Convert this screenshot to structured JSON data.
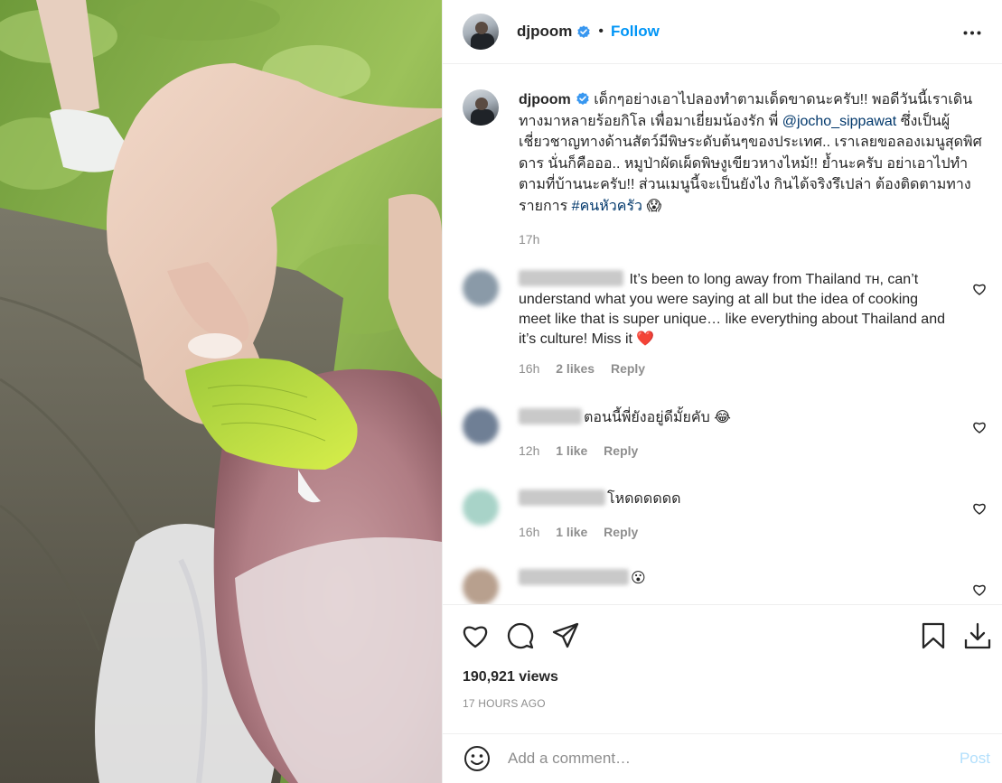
{
  "post": {
    "username": "djpoom",
    "follow_label": "Follow",
    "dot": "•",
    "caption_part1": " เด็กๆอย่างเอาไปลองทำตามเด็ดขาดนะครับ!! พอดีวันนี้เราเดินทางมาหลายร้อยกิโล เพื่อมาเยี่ยมน้องรัก พี่ ",
    "mention": "@jocho_sippawat",
    "caption_part2": " ซึ่งเป็นผู้เชี่ยวชาญทางด้านสัตว์มีพิษระดับต้นๆของประเทศ.. เราเลยขอลองเมนูสุดพิศดาร นั่นก็คือออ.. หมูป่าผัดเผ็ดพิษงูเขียวหางไหม้!! ย้ำนะครับ อย่าเอาไปทำตามที่บ้านนะครับ!! ส่วนเมนูนี้จะเป็นยังไง กินได้จริงรึเปล่า ต้องติดตามทางรายการ ",
    "hashtag": "#คนหัวครัว",
    "caption_emoji": "😱",
    "caption_time": "17h"
  },
  "comments": [
    {
      "text": "It’s been to long away from Thailand ᴛʜ, can’t understand what you were saying at all but the idea of cooking meet like that is super unique… like everything about Thailand and it’s culture! Miss it ❤️",
      "time": "16h",
      "likes": "2 likes",
      "reply": "Reply",
      "avatar_color": "#8a9aa8"
    },
    {
      "text": "ตอนนี้พี่ยังอยู่ดีมั้ยคับ 😂",
      "time": "12h",
      "likes": "1 like",
      "reply": "Reply",
      "avatar_color": "#6f7f95"
    },
    {
      "text": "โหดดดดดด",
      "time": "16h",
      "likes": "1 like",
      "reply": "Reply",
      "avatar_color": "#a8d3c8"
    },
    {
      "text": "😮",
      "time": "",
      "likes": "",
      "reply": "",
      "avatar_color": "#b8a08e"
    }
  ],
  "actions": {
    "views": "190,921 views",
    "timestamp": "17 HOURS AGO"
  },
  "composer": {
    "placeholder": "Add a comment…",
    "post_label": "Post"
  },
  "icons": {
    "verified": "verified-badge-icon",
    "more": "more-options-icon",
    "like": "heart-icon",
    "comment": "comment-icon",
    "share": "share-icon",
    "save": "bookmark-icon",
    "download": "download-icon",
    "emoji": "emoji-icon"
  },
  "colors": {
    "accent": "#0095f6",
    "verified": "#3897f0",
    "mention": "#00376b",
    "muted": "#8e8e8e"
  }
}
